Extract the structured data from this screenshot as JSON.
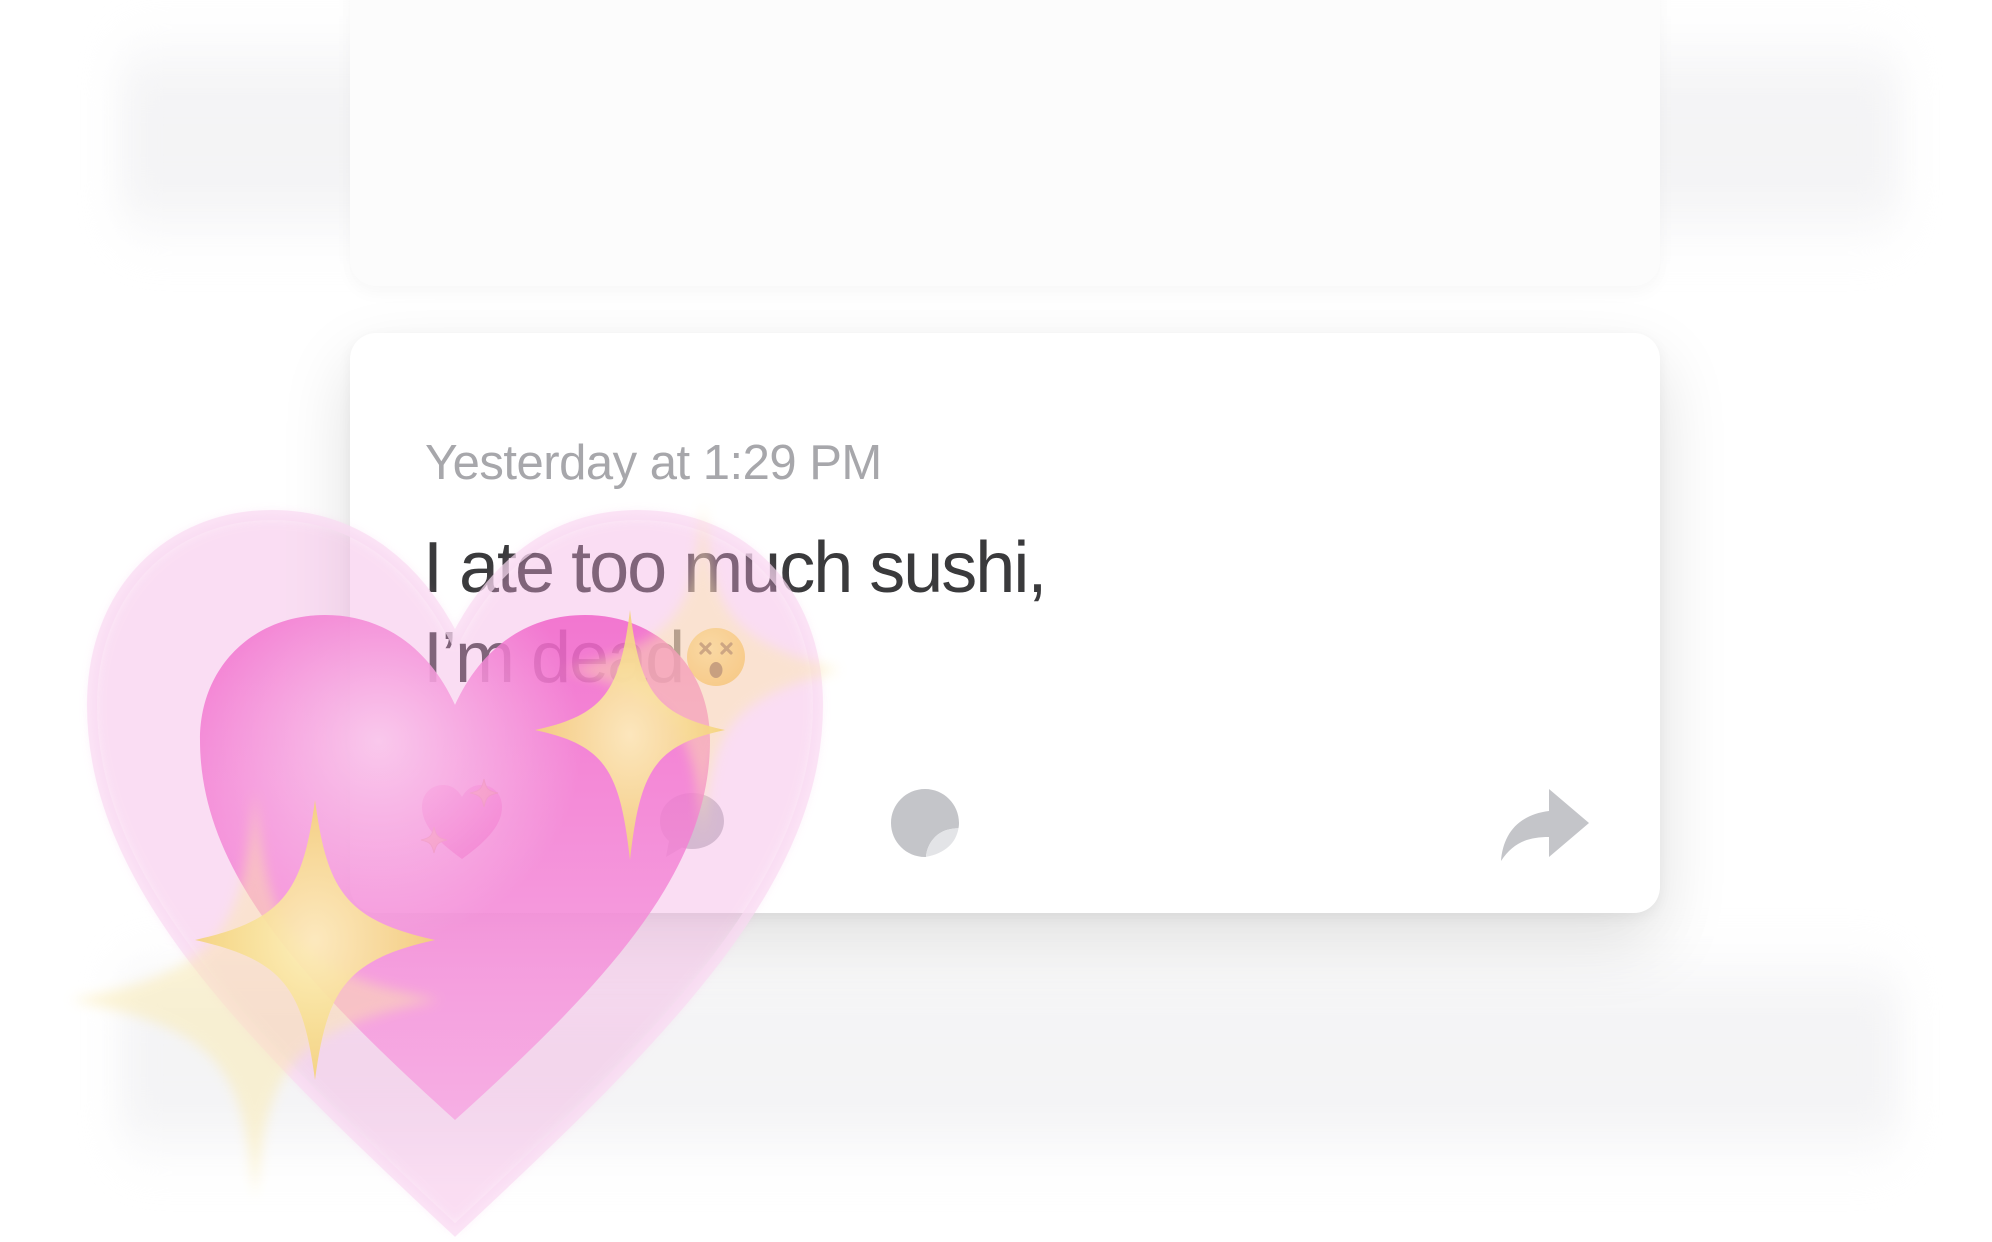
{
  "post": {
    "timestamp": "Yesterday at 1:29 PM",
    "message_line_1": "I ate too much sushi,",
    "message_line_2": "I’m dead"
  },
  "icons": {
    "inline_emoji": "dizzy-face-icon",
    "react": "sparkling-heart-icon",
    "comment": "speech-bubble-icon",
    "sticker": "sticker-icon",
    "share": "share-arrow-icon",
    "effect": "sparkling-heart-animation"
  },
  "colors": {
    "text": "#3a3a3c",
    "timestamp": "#a7a7ab",
    "icon_gray": "#c4c5c9",
    "heart_pink": "#f3a8e0",
    "sparkle_yellow": "#fbe9a8"
  }
}
